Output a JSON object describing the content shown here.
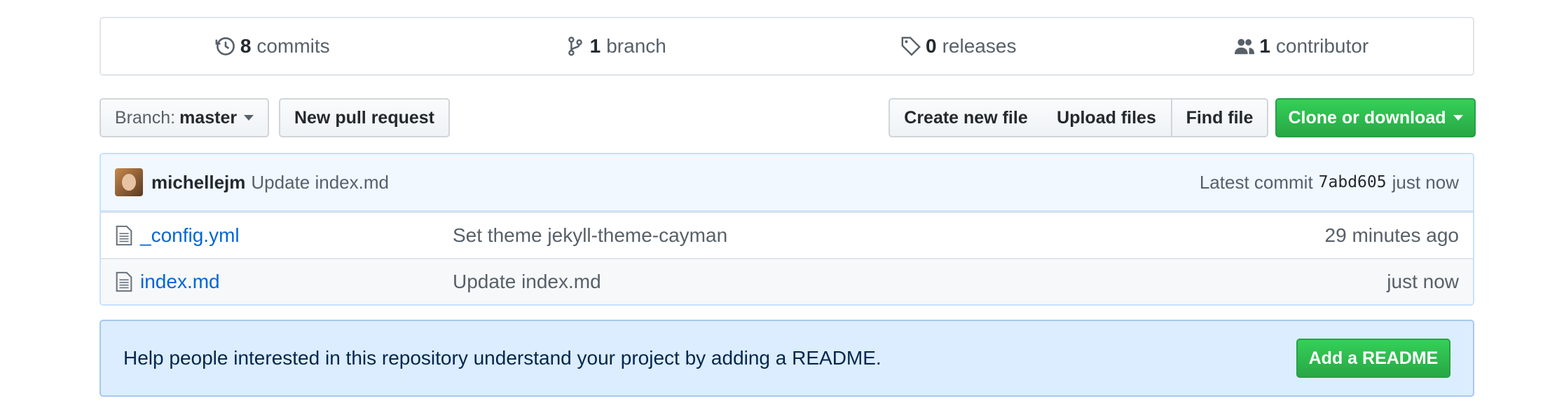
{
  "stats": {
    "commits": {
      "count": "8",
      "label": "commits",
      "icon": "history-icon"
    },
    "branches": {
      "count": "1",
      "label": "branch",
      "icon": "git-branch-icon"
    },
    "releases": {
      "count": "0",
      "label": "releases",
      "icon": "tag-icon"
    },
    "contributors": {
      "count": "1",
      "label": "contributor",
      "icon": "people-icon"
    }
  },
  "toolbar": {
    "branch_prefix": "Branch:",
    "branch_name": "master",
    "new_pr": "New pull request",
    "create_file": "Create new file",
    "upload_files": "Upload files",
    "find_file": "Find file",
    "clone_download": "Clone or download"
  },
  "latest_commit": {
    "author": "michellejm",
    "message": "Update index.md",
    "prefix": "Latest commit",
    "sha": "7abd605",
    "time": "just now"
  },
  "files": [
    {
      "name": "_config.yml",
      "message": "Set theme jekyll-theme-cayman",
      "time": "29 minutes ago"
    },
    {
      "name": "index.md",
      "message": "Update index.md",
      "time": "just now"
    }
  ],
  "readme_banner": {
    "text": "Help people interested in this repository understand your project by adding a README.",
    "button": "Add a README"
  },
  "colors": {
    "primary_green": "#28a745",
    "link_blue": "#0366d6",
    "banner_bg": "#dbedff"
  }
}
